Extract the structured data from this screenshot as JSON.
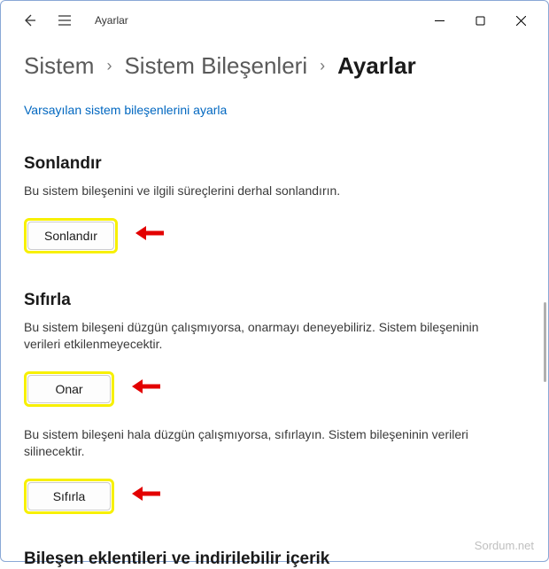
{
  "titlebar": {
    "app_title": "Ayarlar"
  },
  "breadcrumb": {
    "items": [
      "Sistem",
      "Sistem Bileşenleri",
      "Ayarlar"
    ]
  },
  "defaults_link": "Varsayılan sistem bileşenlerini ayarla",
  "sections": {
    "terminate": {
      "title": "Sonlandır",
      "desc": "Bu sistem bileşenini ve ilgili süreçlerini derhal sonlandırın.",
      "button": "Sonlandır"
    },
    "reset": {
      "title": "Sıfırla",
      "desc1": "Bu sistem bileşeni düzgün çalışmıyorsa, onarmayı deneyebiliriz. Sistem bileşeninin verileri etkilenmeyecektir.",
      "repair_button": "Onar",
      "desc2": "Bu sistem bileşeni hala düzgün çalışmıyorsa, sıfırlayın. Sistem bileşeninin verileri silinecektir.",
      "reset_button": "Sıfırla"
    },
    "addons": {
      "title": "Bileşen eklentileri ve indirilebilir içerik"
    }
  },
  "watermark": "Sordum.net"
}
